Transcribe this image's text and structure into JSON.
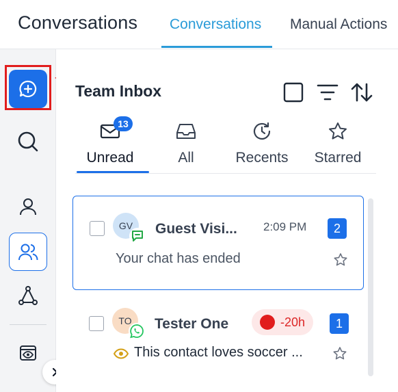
{
  "header": {
    "app_title": "Conversations",
    "tabs": [
      {
        "label": "Conversations",
        "active": true
      },
      {
        "label": "Manual Actions",
        "active": false
      }
    ]
  },
  "rail": {
    "items": [
      {
        "name": "new-conversation",
        "icon": "chat-plus-icon",
        "state": "primary"
      },
      {
        "name": "search",
        "icon": "search-icon"
      },
      {
        "name": "contact",
        "icon": "user-icon"
      },
      {
        "name": "team",
        "icon": "users-icon",
        "state": "selected"
      },
      {
        "name": "network",
        "icon": "nodes-icon"
      },
      {
        "name": "preview",
        "icon": "eye-window-icon"
      }
    ],
    "collapse_icon": "chevron-right-icon"
  },
  "inbox": {
    "title": "Team Inbox",
    "header_icons": [
      "checkbox-icon",
      "filter-lines-icon",
      "sort-arrows-icon"
    ],
    "filters": [
      {
        "label": "Unread",
        "icon": "envelope-icon",
        "count": "13",
        "active": true
      },
      {
        "label": "All",
        "icon": "inbox-tray-icon"
      },
      {
        "label": "Recents",
        "icon": "clock-refresh-icon"
      },
      {
        "label": "Starred",
        "icon": "star-icon"
      }
    ]
  },
  "conversations": [
    {
      "initials": "GV",
      "channel_icon": "chat-bubble-icon",
      "name": "Guest Visi...",
      "time": "2:09 PM",
      "unread": "2",
      "preview": "Your chat has ended",
      "selected": true,
      "avatar_color": "#cfe3f7",
      "channel_color": "#22a845"
    },
    {
      "initials": "TO",
      "channel_icon": "whatsapp-icon",
      "name": "Tester One",
      "sla": "-20h",
      "unread": "1",
      "preview_icon": "eye-icon",
      "preview": "This contact loves soccer ...",
      "selected": false,
      "avatar_color": "#f9dcc4",
      "channel_color": "#22c55e"
    }
  ],
  "colors": {
    "accent": "#1c6fe8",
    "tab_accent": "#2a9bd8",
    "annotation": "#e11d1d"
  }
}
